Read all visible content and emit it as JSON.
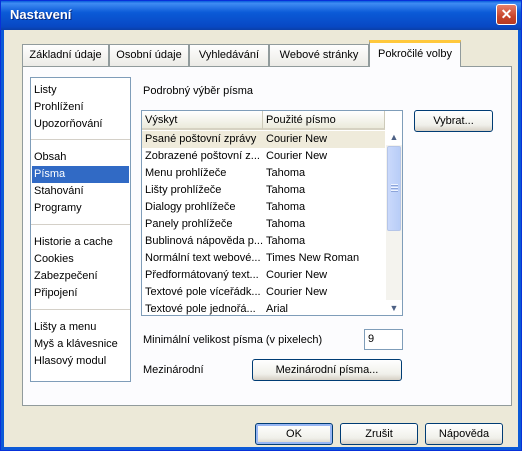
{
  "window": {
    "title": "Nastavení",
    "close_glyph": "✕"
  },
  "tabs": [
    {
      "label": "Základní údaje"
    },
    {
      "label": "Osobní údaje"
    },
    {
      "label": "Vyhledávání"
    },
    {
      "label": "Webové stránky"
    },
    {
      "label": "Pokročilé volby"
    }
  ],
  "active_tab_index": 4,
  "sidebar": {
    "items": [
      "Listy",
      "Prohlížení",
      "Upozorňování",
      "Obsah",
      "Písma",
      "Stahování",
      "Programy",
      "Historie a cache",
      "Cookies",
      "Zabezpečení",
      "Připojení",
      "Lišty a menu",
      "Myš a klávesnice",
      "Hlasový modul"
    ],
    "selected": "Písma"
  },
  "fonts_section": {
    "heading": "Podrobný výběr písma",
    "select_button": "Vybrat...",
    "columns": [
      "Výskyt",
      "Použité písmo"
    ],
    "rows": [
      [
        "Psané poštovní zprávy",
        "Courier New"
      ],
      [
        "Zobrazené poštovní z...",
        "Courier New"
      ],
      [
        "Menu prohlížeče",
        "Tahoma"
      ],
      [
        "Lišty prohlížeče",
        "Tahoma"
      ],
      [
        "Dialogy prohlížeče",
        "Tahoma"
      ],
      [
        "Panely prohlížeče",
        "Tahoma"
      ],
      [
        "Bublinová nápověda p...",
        "Tahoma"
      ],
      [
        "Normální text webové...",
        "Times New Roman"
      ],
      [
        "Předformátovaný text...",
        "Courier New"
      ],
      [
        "Textové pole víceřádk...",
        "Courier New"
      ],
      [
        "Textové pole jednořá...",
        "Arial"
      ]
    ],
    "selected_row": 0,
    "scroll_up_glyph": "▲",
    "scroll_down_glyph": "▼",
    "min_size_label": "Minimální velikost písma (v pixelech)",
    "min_size_value": "9",
    "international_label": "Mezinárodní",
    "international_button": "Mezinárodní písma..."
  },
  "footer": {
    "ok": "OK",
    "cancel": "Zrušit",
    "help": "Nápověda"
  },
  "icons": {
    "close": "close-icon",
    "scroll_up": "chevron-up-icon",
    "scroll_down": "chevron-down-icon"
  },
  "colors": {
    "titlebar": "#0b5ad7",
    "selection": "#316ac5",
    "active_tab_accent": "#ffc83c",
    "close_button": "#c8452c"
  }
}
